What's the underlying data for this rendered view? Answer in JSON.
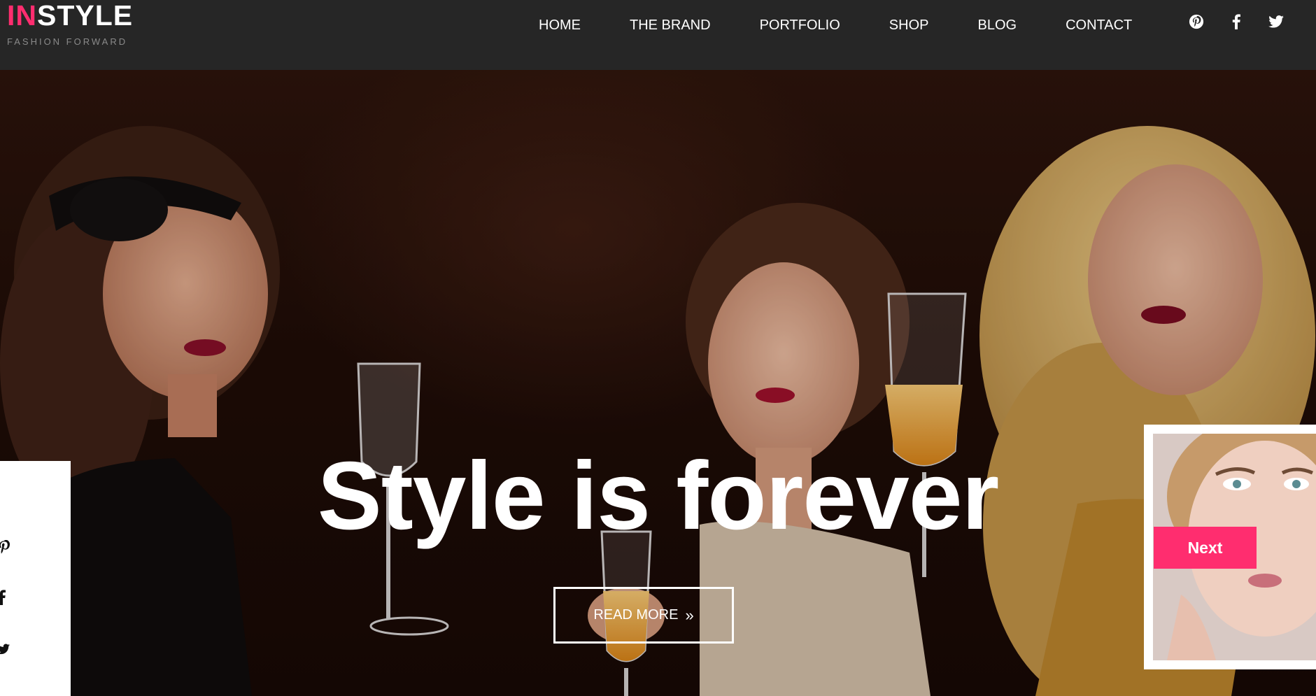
{
  "brand": {
    "logo_accent": "IN",
    "logo_rest": "STYLE",
    "tagline": "FASHION FORWARD",
    "accent_color": "#ff2d6f"
  },
  "nav": {
    "items": [
      {
        "label": "HOME"
      },
      {
        "label": "THE BRAND"
      },
      {
        "label": "PORTFOLIO"
      },
      {
        "label": "SHOP"
      },
      {
        "label": "BLOG"
      },
      {
        "label": "CONTACT"
      }
    ]
  },
  "social_top": [
    "pinterest-icon",
    "facebook-icon",
    "twitter-icon"
  ],
  "hero": {
    "title": "Style is forever",
    "read_more_label": "READ MORE",
    "read_more_icon": "double-chevron-right-icon"
  },
  "side_social": [
    "pinterest-icon",
    "facebook-icon",
    "twitter-icon"
  ],
  "slider": {
    "next_label": "Next"
  },
  "colors": {
    "header_bg": "#262626",
    "accent": "#ff2d6f",
    "text_light": "#ffffff"
  }
}
